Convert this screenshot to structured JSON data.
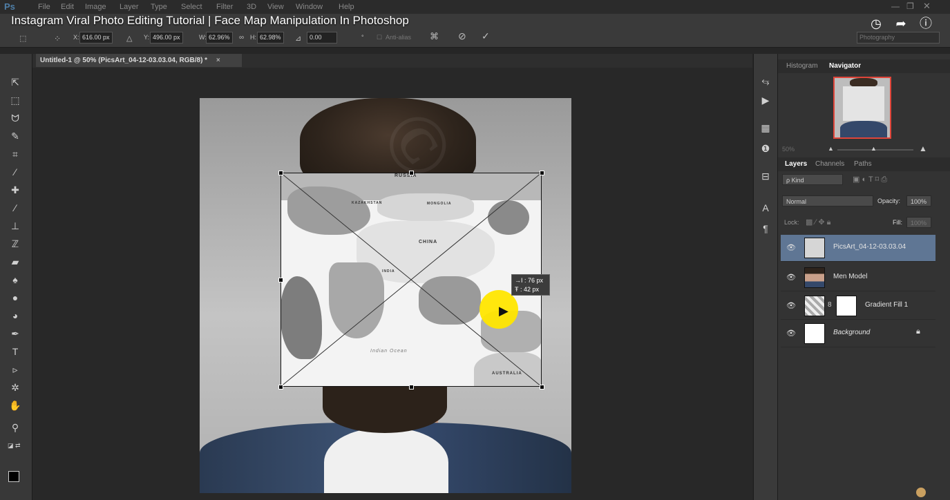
{
  "video": {
    "title": "Instagram Viral Photo Editing Tutorial | Face Map Manipulation In Photoshop",
    "icons": [
      "clock-icon",
      "share-icon",
      "info-icon"
    ]
  },
  "app": {
    "logo": "Ps",
    "menu": [
      "File",
      "Edit",
      "Image",
      "Layer",
      "Type",
      "Select",
      "Filter",
      "3D",
      "View",
      "Window",
      "Help"
    ],
    "workspace": "Photography"
  },
  "options": {
    "x_label": "X:",
    "x_value": "616.00 px",
    "y_label": "Y:",
    "y_value": "496.00 px",
    "w_label": "W:",
    "w_value": "62.96%",
    "h_label": "H:",
    "h_value": "62.98%",
    "angle_value": "0.00",
    "deg": "°",
    "antialias": "Anti-alias"
  },
  "document": {
    "tab": "Untitled-1 @ 50% (PicsArt_04-12-03.03.04, RGB/8) *",
    "close": "×"
  },
  "map": {
    "labels": [
      "RUSSIA",
      "KAZAKHSTAN",
      "MONGOLIA",
      "CHINA",
      "INDIA",
      "Indian Ocean",
      "AUSTRALIA"
    ]
  },
  "tooltip": {
    "line1": "→I : 76 px",
    "line2": "Ŧ : 42 px"
  },
  "navigator": {
    "tabs": [
      "Histogram",
      "Navigator"
    ],
    "zoom": "50%"
  },
  "layers_panel": {
    "tabs": [
      "Layers",
      "Channels",
      "Paths"
    ],
    "kind": "ρ Kind",
    "blend_mode": "Normal",
    "opacity_label": "Opacity:",
    "opacity_value": "100%",
    "lock_label": "Lock:",
    "fill_label": "Fill:",
    "fill_value": "100%",
    "layers": [
      {
        "name": "PicsArt_04-12-03.03.04",
        "selected": true
      },
      {
        "name": "Men Model",
        "selected": false
      },
      {
        "name": "Gradient Fill 1",
        "selected": false
      },
      {
        "name": "Background",
        "selected": false
      }
    ]
  }
}
